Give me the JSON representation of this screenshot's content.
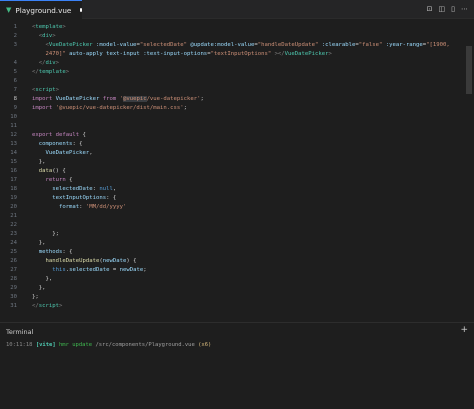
{
  "tab": {
    "icon": "vue-logo-icon",
    "filename": "Playground.vue",
    "modified": true
  },
  "actions": [
    {
      "name": "open-preview-icon",
      "glyph": "⊡"
    },
    {
      "name": "git-compare-icon",
      "glyph": "◫"
    },
    {
      "name": "split-editor-icon",
      "glyph": "▯"
    },
    {
      "name": "more-actions-icon",
      "glyph": "⋯"
    }
  ],
  "editor": {
    "active_line": 8,
    "lines": [
      {
        "n": "1",
        "tokens": [
          [
            "t-tag",
            "<"
          ],
          [
            "t-comp",
            "template"
          ],
          [
            "t-tag",
            ">"
          ]
        ]
      },
      {
        "n": "2",
        "tokens": [
          [
            "t-punc",
            "  "
          ],
          [
            "t-tag",
            "<"
          ],
          [
            "t-comp",
            "div"
          ],
          [
            "t-tag",
            ">"
          ]
        ]
      },
      {
        "n": "3",
        "tokens": [
          [
            "t-punc",
            "    "
          ],
          [
            "t-tag",
            "<"
          ],
          [
            "t-comp",
            "VueDatePicker"
          ],
          [
            "t-punc",
            " "
          ],
          [
            "t-attr",
            ":model-value"
          ],
          [
            "t-punc",
            "="
          ],
          [
            "t-str",
            "\"selectedDate\""
          ],
          [
            "t-punc",
            " "
          ],
          [
            "t-attr",
            "@update:model-value"
          ],
          [
            "t-punc",
            "="
          ],
          [
            "t-str",
            "\"handleDateUpdate\""
          ],
          [
            "t-punc",
            " "
          ],
          [
            "t-attr",
            ":clearable"
          ],
          [
            "t-punc",
            "="
          ],
          [
            "t-str",
            "\"false\""
          ],
          [
            "t-punc",
            " "
          ],
          [
            "t-attr",
            ":year-range"
          ],
          [
            "t-punc",
            "="
          ],
          [
            "t-str",
            "\"[1900,"
          ]
        ]
      },
      {
        "n": "",
        "tokens": [
          [
            "t-str",
            "    2470]\""
          ],
          [
            "t-punc",
            " "
          ],
          [
            "t-attr",
            "auto-apply"
          ],
          [
            "t-punc",
            " "
          ],
          [
            "t-attr",
            "text-input"
          ],
          [
            "t-punc",
            " "
          ],
          [
            "t-attr",
            ":text-input-options"
          ],
          [
            "t-punc",
            "="
          ],
          [
            "t-str",
            "\"textInputOptions\""
          ],
          [
            "t-punc",
            " "
          ],
          [
            "t-tag",
            "></"
          ],
          [
            "t-comp",
            "VueDatePicker"
          ],
          [
            "t-tag",
            ">"
          ]
        ]
      },
      {
        "n": "4",
        "tokens": [
          [
            "t-punc",
            "  "
          ],
          [
            "t-tag",
            "</"
          ],
          [
            "t-comp",
            "div"
          ],
          [
            "t-tag",
            ">"
          ]
        ]
      },
      {
        "n": "5",
        "tokens": [
          [
            "t-tag",
            "</"
          ],
          [
            "t-comp",
            "template"
          ],
          [
            "t-tag",
            ">"
          ]
        ]
      },
      {
        "n": "6",
        "tokens": []
      },
      {
        "n": "7",
        "tokens": [
          [
            "t-tag",
            "<"
          ],
          [
            "t-comp",
            "script"
          ],
          [
            "t-tag",
            ">"
          ]
        ]
      },
      {
        "n": "8",
        "tokens": [
          [
            "t-key",
            "import"
          ],
          [
            "t-punc",
            " "
          ],
          [
            "t-var",
            "VueDatePicker"
          ],
          [
            "t-punc",
            " "
          ],
          [
            "t-key",
            "from"
          ],
          [
            "t-punc",
            " "
          ],
          [
            "t-str",
            "'"
          ],
          [
            "t-str t-sel",
            "@vuepic"
          ],
          [
            "t-str",
            "/vue-datepicker'"
          ],
          [
            "t-punc",
            ";"
          ]
        ]
      },
      {
        "n": "9",
        "tokens": [
          [
            "t-key",
            "import"
          ],
          [
            "t-punc",
            " "
          ],
          [
            "t-str",
            "'@vuepic/vue-datepicker/dist/main.css'"
          ],
          [
            "t-punc",
            ";"
          ]
        ]
      },
      {
        "n": "10",
        "tokens": []
      },
      {
        "n": "11",
        "tokens": []
      },
      {
        "n": "12",
        "tokens": [
          [
            "t-key",
            "export"
          ],
          [
            "t-punc",
            " "
          ],
          [
            "t-key",
            "default"
          ],
          [
            "t-punc",
            " {"
          ]
        ]
      },
      {
        "n": "13",
        "tokens": [
          [
            "t-punc",
            "  "
          ],
          [
            "t-var",
            "components"
          ],
          [
            "t-punc",
            ": {"
          ]
        ]
      },
      {
        "n": "14",
        "tokens": [
          [
            "t-punc",
            "    "
          ],
          [
            "t-var",
            "VueDatePicker"
          ],
          [
            "t-punc",
            ","
          ]
        ]
      },
      {
        "n": "15",
        "tokens": [
          [
            "t-punc",
            "  },"
          ]
        ]
      },
      {
        "n": "16",
        "tokens": [
          [
            "t-punc",
            "  "
          ],
          [
            "t-fn",
            "data"
          ],
          [
            "t-punc",
            "() {"
          ]
        ]
      },
      {
        "n": "17",
        "tokens": [
          [
            "t-punc",
            "    "
          ],
          [
            "t-key",
            "return"
          ],
          [
            "t-punc",
            " {"
          ]
        ]
      },
      {
        "n": "18",
        "tokens": [
          [
            "t-punc",
            "      "
          ],
          [
            "t-var",
            "selectedDate"
          ],
          [
            "t-punc",
            ": "
          ],
          [
            "t-kw",
            "null"
          ],
          [
            "t-punc",
            ","
          ]
        ]
      },
      {
        "n": "19",
        "tokens": [
          [
            "t-punc",
            "      "
          ],
          [
            "t-var",
            "textInputOptions"
          ],
          [
            "t-punc",
            ": {"
          ]
        ]
      },
      {
        "n": "20",
        "tokens": [
          [
            "t-punc",
            "        "
          ],
          [
            "t-var",
            "format"
          ],
          [
            "t-punc",
            ": "
          ],
          [
            "t-str",
            "'MM/dd/yyyy'"
          ]
        ]
      },
      {
        "n": "21",
        "tokens": []
      },
      {
        "n": "22",
        "tokens": []
      },
      {
        "n": "23",
        "tokens": [
          [
            "t-punc",
            "      };"
          ]
        ]
      },
      {
        "n": "24",
        "tokens": [
          [
            "t-punc",
            "  },"
          ]
        ]
      },
      {
        "n": "25",
        "tokens": [
          [
            "t-punc",
            "  "
          ],
          [
            "t-var",
            "methods"
          ],
          [
            "t-punc",
            ": {"
          ]
        ]
      },
      {
        "n": "26",
        "tokens": [
          [
            "t-punc",
            "    "
          ],
          [
            "t-fn",
            "handleDateUpdate"
          ],
          [
            "t-punc",
            "("
          ],
          [
            "t-var",
            "newDate"
          ],
          [
            "t-punc",
            ") {"
          ]
        ]
      },
      {
        "n": "27",
        "tokens": [
          [
            "t-punc",
            "      "
          ],
          [
            "t-kw",
            "this"
          ],
          [
            "t-punc",
            "."
          ],
          [
            "t-var",
            "selectedDate"
          ],
          [
            "t-punc",
            " = "
          ],
          [
            "t-var",
            "newDate"
          ],
          [
            "t-punc",
            ";"
          ]
        ]
      },
      {
        "n": "28",
        "tokens": [
          [
            "t-punc",
            "    },"
          ]
        ]
      },
      {
        "n": "29",
        "tokens": [
          [
            "t-punc",
            "  },"
          ]
        ]
      },
      {
        "n": "30",
        "tokens": [
          [
            "t-punc",
            "};"
          ]
        ]
      },
      {
        "n": "31",
        "tokens": [
          [
            "t-tag",
            "</"
          ],
          [
            "t-comp",
            "script"
          ],
          [
            "t-tag",
            ">"
          ]
        ]
      }
    ]
  },
  "terminal": {
    "title": "Terminal",
    "add_icon": "plus-icon",
    "time": "10:11:18",
    "tag": "[vite]",
    "event": "hmr update",
    "path": "/src/components/Playground.vue",
    "count": "(x6)"
  }
}
